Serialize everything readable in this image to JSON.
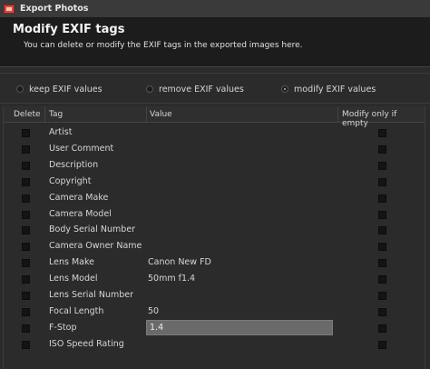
{
  "window": {
    "title": "Export Photos"
  },
  "header": {
    "title": "Modify EXIF tags",
    "subtitle": "You can delete or modify the EXIF tags in the exported images here."
  },
  "options": {
    "keep": "keep EXIF values",
    "remove": "remove EXIF values",
    "modify": "modify EXIF values",
    "selected": "modify"
  },
  "table": {
    "columns": {
      "delete": "Delete",
      "tag": "Tag",
      "value": "Value",
      "modify_only": "Modify only if empty"
    },
    "rows": [
      {
        "tag": "Artist",
        "value": ""
      },
      {
        "tag": "User Comment",
        "value": ""
      },
      {
        "tag": "Description",
        "value": ""
      },
      {
        "tag": "Copyright",
        "value": ""
      },
      {
        "tag": "Camera Make",
        "value": ""
      },
      {
        "tag": "Camera Model",
        "value": ""
      },
      {
        "tag": "Body Serial Number",
        "value": ""
      },
      {
        "tag": "Camera Owner Name",
        "value": ""
      },
      {
        "tag": "Lens Make",
        "value": "Canon New FD"
      },
      {
        "tag": "Lens Model",
        "value": "50mm f1.4"
      },
      {
        "tag": "Lens Serial Number",
        "value": ""
      },
      {
        "tag": "Focal Length",
        "value": "50"
      },
      {
        "tag": "F-Stop",
        "value": "1.4"
      },
      {
        "tag": "ISO Speed Rating",
        "value": ""
      }
    ],
    "editing_row": 12
  },
  "colors": {
    "header_bg": "#1c1c1c",
    "panel_bg": "#2b2b2b",
    "input_bg": "#6a6a6a",
    "icon_red": "#d9483b"
  }
}
